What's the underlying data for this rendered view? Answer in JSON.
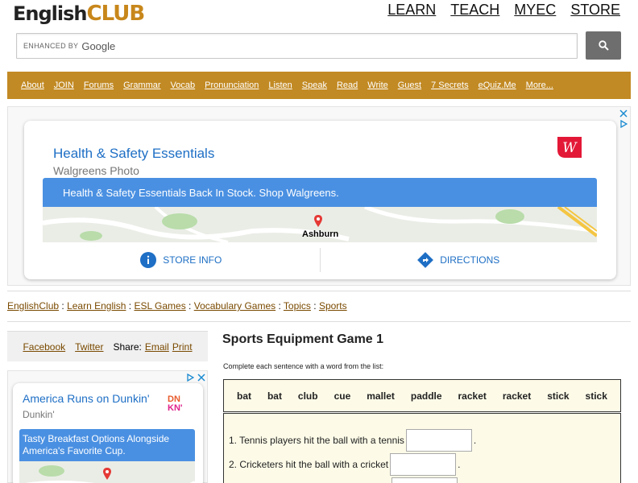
{
  "header": {
    "logo_part1": "English",
    "logo_part2": "CLUB",
    "top_nav": [
      "LEARN",
      "TEACH",
      "MYEC",
      "STORE"
    ],
    "search_enhanced": "ENHANCED BY",
    "search_google": "Google"
  },
  "nav": [
    "About",
    "JOIN",
    "Forums",
    "Grammar",
    "Vocab",
    "Pronunciation",
    "Listen",
    "Speak",
    "Read",
    "Write",
    "Guest",
    "7 Secrets",
    "eQuiz.Me",
    "More..."
  ],
  "ad_top": {
    "title": "Health & Safety Essentials",
    "advertiser": "Walgreens Photo",
    "banner": "Health & Safety Essentials Back In Stock. Shop Walgreens.",
    "map_label": "Ashburn",
    "action_store": "STORE INFO",
    "action_directions": "DIRECTIONS",
    "brand_color": "#e31837",
    "accent_color": "#4a90e2"
  },
  "breadcrumb": [
    {
      "label": "EnglishClub"
    },
    {
      "label": "Learn English"
    },
    {
      "label": "ESL Games"
    },
    {
      "label": "Vocabulary Games"
    },
    {
      "label": "Topics"
    },
    {
      "label": "Sports"
    }
  ],
  "breadcrumb_sep": " : ",
  "share": {
    "facebook": "Facebook",
    "twitter": "Twitter",
    "share_label": "Share:",
    "email": "Email",
    "print": "Print"
  },
  "ad_left": {
    "title": "America Runs on Dunkin'",
    "advertiser": "Dunkin'",
    "logo_top": "DN",
    "logo_bottom": "KN'",
    "banner": "Tasty Breakfast Options Alongside America's Favorite Cup."
  },
  "game": {
    "title": "Sports Equipment Game 1",
    "instructions": "Complete each sentence with a word from the list:",
    "words": [
      "bat",
      "bat",
      "club",
      "cue",
      "mallet",
      "paddle",
      "racket",
      "racket",
      "stick",
      "stick"
    ],
    "questions": [
      {
        "text": "1. Tennis players hit the ball with a tennis",
        "answer": ""
      },
      {
        "text": "2. Cricketers hit the ball with a cricket",
        "answer": ""
      },
      {
        "text": "",
        "answer": ""
      }
    ]
  }
}
